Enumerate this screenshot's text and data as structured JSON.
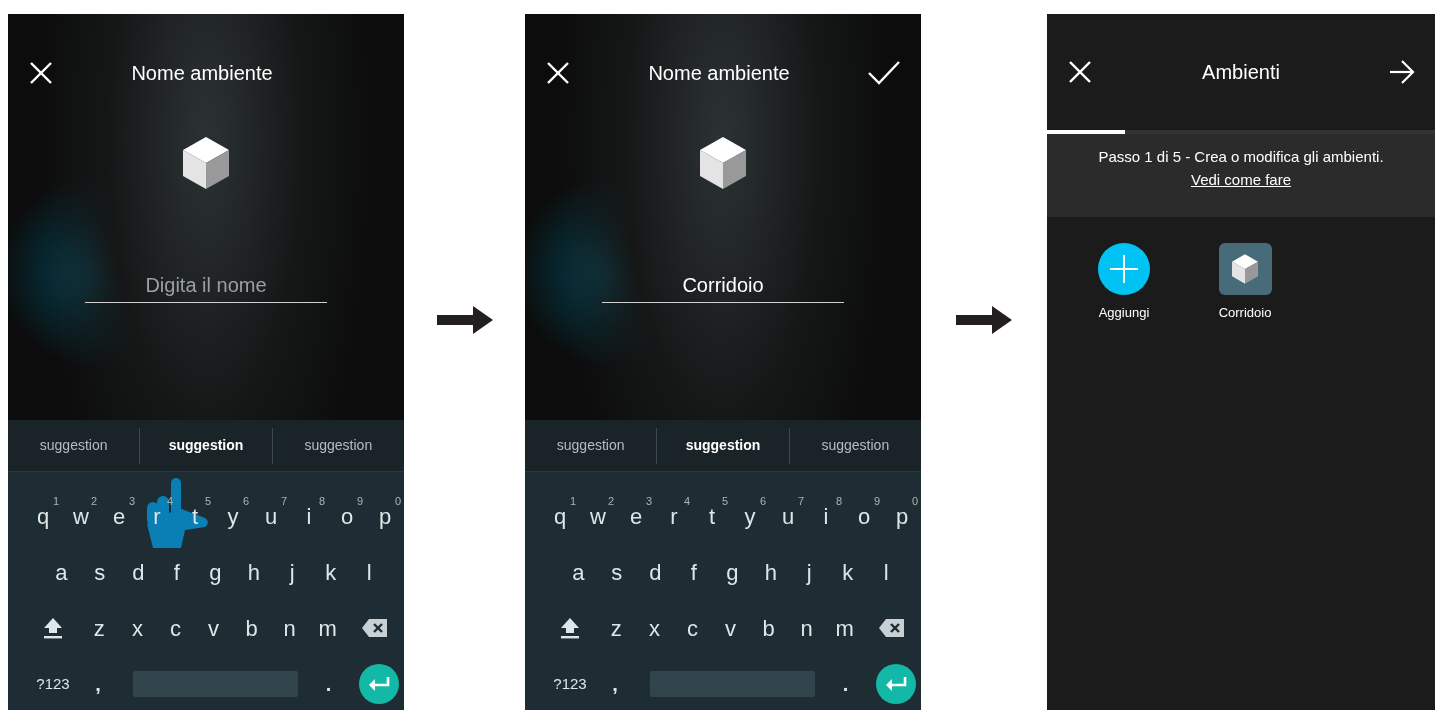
{
  "screens": [
    {
      "kind": "name_entry",
      "title": "Nome ambiente",
      "confirm": false,
      "field": {
        "placeholder": "Digita il nome"
      },
      "touch_hint": true,
      "suggestions": [
        {
          "label": "suggestion",
          "selected": false
        },
        {
          "label": "suggestion",
          "selected": true
        },
        {
          "label": "suggestion",
          "selected": false
        }
      ],
      "keyboard": [
        [
          {
            "label": "q",
            "hint": "1"
          },
          {
            "label": "w",
            "hint": "2"
          },
          {
            "label": "e",
            "hint": "3"
          },
          {
            "label": "r",
            "hint": "4"
          },
          {
            "label": "t",
            "hint": "5"
          },
          {
            "label": "y",
            "hint": "6"
          },
          {
            "label": "u",
            "hint": "7"
          },
          {
            "label": "i",
            "hint": "8"
          },
          {
            "label": "o",
            "hint": "9"
          },
          {
            "label": "p",
            "hint": "0"
          }
        ],
        [
          {
            "label": "a"
          },
          {
            "label": "s"
          },
          {
            "label": "d"
          },
          {
            "label": "f"
          },
          {
            "label": "g"
          },
          {
            "label": "h"
          },
          {
            "label": "j"
          },
          {
            "label": "k"
          },
          {
            "label": "l"
          }
        ],
        [
          {
            "kind": "shift"
          },
          {
            "label": "z"
          },
          {
            "label": "x"
          },
          {
            "label": "c"
          },
          {
            "label": "v"
          },
          {
            "label": "b"
          },
          {
            "label": "n"
          },
          {
            "label": "m"
          },
          {
            "kind": "backspace"
          }
        ],
        [
          {
            "kind": "symbols",
            "label": "?123"
          },
          {
            "kind": "comma",
            "label": ","
          },
          {
            "kind": "space"
          },
          {
            "kind": "period",
            "label": "."
          },
          {
            "kind": "enter"
          }
        ]
      ]
    },
    {
      "kind": "name_entry",
      "title": "Nome ambiente",
      "confirm": true,
      "field": {
        "value": "Corridoio"
      },
      "touch_hint": false,
      "suggestions": [
        {
          "label": "suggestion",
          "selected": false
        },
        {
          "label": "suggestion",
          "selected": true
        },
        {
          "label": "suggestion",
          "selected": false
        }
      ],
      "keyboard": [
        [
          {
            "label": "q",
            "hint": "1"
          },
          {
            "label": "w",
            "hint": "2"
          },
          {
            "label": "e",
            "hint": "3"
          },
          {
            "label": "r",
            "hint": "4"
          },
          {
            "label": "t",
            "hint": "5"
          },
          {
            "label": "y",
            "hint": "6"
          },
          {
            "label": "u",
            "hint": "7"
          },
          {
            "label": "i",
            "hint": "8"
          },
          {
            "label": "o",
            "hint": "9"
          },
          {
            "label": "p",
            "hint": "0"
          }
        ],
        [
          {
            "label": "a"
          },
          {
            "label": "s"
          },
          {
            "label": "d"
          },
          {
            "label": "f"
          },
          {
            "label": "g"
          },
          {
            "label": "h"
          },
          {
            "label": "j"
          },
          {
            "label": "k"
          },
          {
            "label": "l"
          }
        ],
        [
          {
            "kind": "shift"
          },
          {
            "label": "z"
          },
          {
            "label": "x"
          },
          {
            "label": "c"
          },
          {
            "label": "v"
          },
          {
            "label": "b"
          },
          {
            "label": "n"
          },
          {
            "label": "m"
          },
          {
            "kind": "backspace"
          }
        ],
        [
          {
            "kind": "symbols",
            "label": "?123"
          },
          {
            "kind": "comma",
            "label": ","
          },
          {
            "kind": "space"
          },
          {
            "kind": "period",
            "label": "."
          },
          {
            "kind": "enter"
          }
        ]
      ]
    },
    {
      "kind": "rooms",
      "title": "Ambienti",
      "progress": {
        "level": 0.2
      },
      "step_text": "Passo 1 di 5 - Crea o modifica gli ambienti.",
      "help_link": "Vedi come fare",
      "items": [
        {
          "kind": "add",
          "label": "Aggiungi"
        },
        {
          "kind": "room",
          "label": "Corridoio"
        }
      ]
    }
  ]
}
